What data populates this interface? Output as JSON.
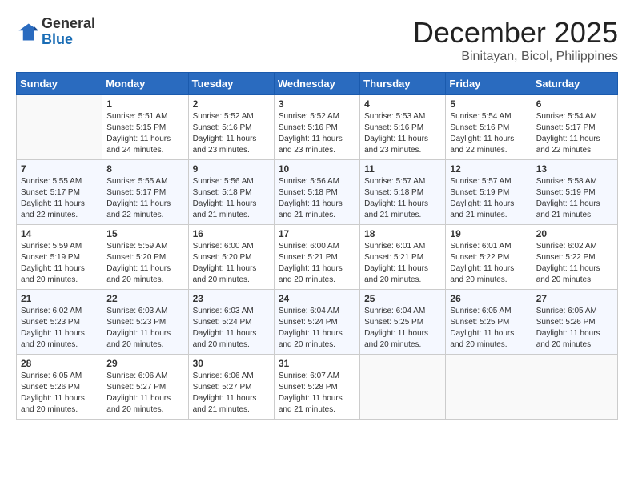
{
  "header": {
    "logo_line1": "General",
    "logo_line2": "Blue",
    "title": "December 2025",
    "subtitle": "Binitayan, Bicol, Philippines"
  },
  "weekdays": [
    "Sunday",
    "Monday",
    "Tuesday",
    "Wednesday",
    "Thursday",
    "Friday",
    "Saturday"
  ],
  "weeks": [
    [
      {
        "day": "",
        "info": ""
      },
      {
        "day": "1",
        "info": "Sunrise: 5:51 AM\nSunset: 5:15 PM\nDaylight: 11 hours\nand 24 minutes."
      },
      {
        "day": "2",
        "info": "Sunrise: 5:52 AM\nSunset: 5:16 PM\nDaylight: 11 hours\nand 23 minutes."
      },
      {
        "day": "3",
        "info": "Sunrise: 5:52 AM\nSunset: 5:16 PM\nDaylight: 11 hours\nand 23 minutes."
      },
      {
        "day": "4",
        "info": "Sunrise: 5:53 AM\nSunset: 5:16 PM\nDaylight: 11 hours\nand 23 minutes."
      },
      {
        "day": "5",
        "info": "Sunrise: 5:54 AM\nSunset: 5:16 PM\nDaylight: 11 hours\nand 22 minutes."
      },
      {
        "day": "6",
        "info": "Sunrise: 5:54 AM\nSunset: 5:17 PM\nDaylight: 11 hours\nand 22 minutes."
      }
    ],
    [
      {
        "day": "7",
        "info": "Sunrise: 5:55 AM\nSunset: 5:17 PM\nDaylight: 11 hours\nand 22 minutes."
      },
      {
        "day": "8",
        "info": "Sunrise: 5:55 AM\nSunset: 5:17 PM\nDaylight: 11 hours\nand 22 minutes."
      },
      {
        "day": "9",
        "info": "Sunrise: 5:56 AM\nSunset: 5:18 PM\nDaylight: 11 hours\nand 21 minutes."
      },
      {
        "day": "10",
        "info": "Sunrise: 5:56 AM\nSunset: 5:18 PM\nDaylight: 11 hours\nand 21 minutes."
      },
      {
        "day": "11",
        "info": "Sunrise: 5:57 AM\nSunset: 5:18 PM\nDaylight: 11 hours\nand 21 minutes."
      },
      {
        "day": "12",
        "info": "Sunrise: 5:57 AM\nSunset: 5:19 PM\nDaylight: 11 hours\nand 21 minutes."
      },
      {
        "day": "13",
        "info": "Sunrise: 5:58 AM\nSunset: 5:19 PM\nDaylight: 11 hours\nand 21 minutes."
      }
    ],
    [
      {
        "day": "14",
        "info": "Sunrise: 5:59 AM\nSunset: 5:19 PM\nDaylight: 11 hours\nand 20 minutes."
      },
      {
        "day": "15",
        "info": "Sunrise: 5:59 AM\nSunset: 5:20 PM\nDaylight: 11 hours\nand 20 minutes."
      },
      {
        "day": "16",
        "info": "Sunrise: 6:00 AM\nSunset: 5:20 PM\nDaylight: 11 hours\nand 20 minutes."
      },
      {
        "day": "17",
        "info": "Sunrise: 6:00 AM\nSunset: 5:21 PM\nDaylight: 11 hours\nand 20 minutes."
      },
      {
        "day": "18",
        "info": "Sunrise: 6:01 AM\nSunset: 5:21 PM\nDaylight: 11 hours\nand 20 minutes."
      },
      {
        "day": "19",
        "info": "Sunrise: 6:01 AM\nSunset: 5:22 PM\nDaylight: 11 hours\nand 20 minutes."
      },
      {
        "day": "20",
        "info": "Sunrise: 6:02 AM\nSunset: 5:22 PM\nDaylight: 11 hours\nand 20 minutes."
      }
    ],
    [
      {
        "day": "21",
        "info": "Sunrise: 6:02 AM\nSunset: 5:23 PM\nDaylight: 11 hours\nand 20 minutes."
      },
      {
        "day": "22",
        "info": "Sunrise: 6:03 AM\nSunset: 5:23 PM\nDaylight: 11 hours\nand 20 minutes."
      },
      {
        "day": "23",
        "info": "Sunrise: 6:03 AM\nSunset: 5:24 PM\nDaylight: 11 hours\nand 20 minutes."
      },
      {
        "day": "24",
        "info": "Sunrise: 6:04 AM\nSunset: 5:24 PM\nDaylight: 11 hours\nand 20 minutes."
      },
      {
        "day": "25",
        "info": "Sunrise: 6:04 AM\nSunset: 5:25 PM\nDaylight: 11 hours\nand 20 minutes."
      },
      {
        "day": "26",
        "info": "Sunrise: 6:05 AM\nSunset: 5:25 PM\nDaylight: 11 hours\nand 20 minutes."
      },
      {
        "day": "27",
        "info": "Sunrise: 6:05 AM\nSunset: 5:26 PM\nDaylight: 11 hours\nand 20 minutes."
      }
    ],
    [
      {
        "day": "28",
        "info": "Sunrise: 6:05 AM\nSunset: 5:26 PM\nDaylight: 11 hours\nand 20 minutes."
      },
      {
        "day": "29",
        "info": "Sunrise: 6:06 AM\nSunset: 5:27 PM\nDaylight: 11 hours\nand 20 minutes."
      },
      {
        "day": "30",
        "info": "Sunrise: 6:06 AM\nSunset: 5:27 PM\nDaylight: 11 hours\nand 21 minutes."
      },
      {
        "day": "31",
        "info": "Sunrise: 6:07 AM\nSunset: 5:28 PM\nDaylight: 11 hours\nand 21 minutes."
      },
      {
        "day": "",
        "info": ""
      },
      {
        "day": "",
        "info": ""
      },
      {
        "day": "",
        "info": ""
      }
    ]
  ]
}
